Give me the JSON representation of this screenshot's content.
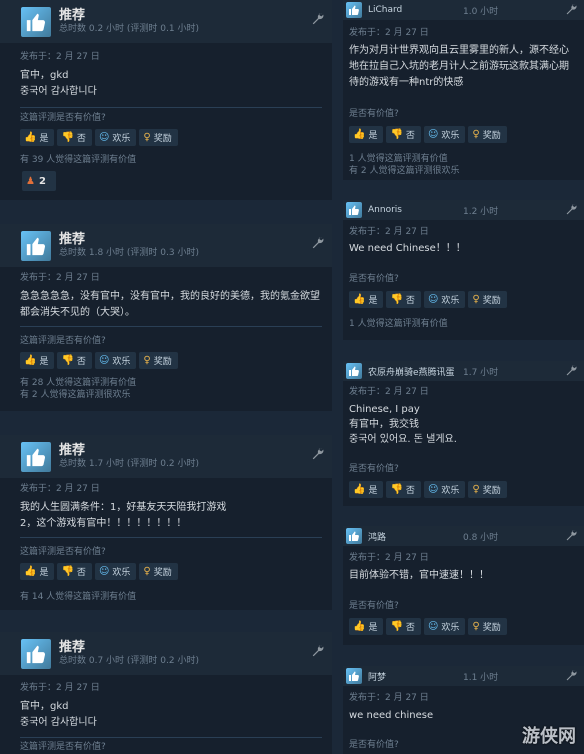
{
  "common": {
    "recommend": "推荐",
    "helpful_q": "这篇评测是否有价值?",
    "yes": "是",
    "no": "否",
    "funny": "欢乐",
    "award": "奖励",
    "helpful_q_short": "是否有价值?"
  },
  "left_reviews": [
    {
      "hours": "总时数 0.2 小时  (评测时 0.1 小时)",
      "posted": "发布于：2 月 27 日",
      "body": [
        "官中，gkd",
        "중국어 감사합니다"
      ],
      "helpful": [
        "有 39 人觉得这篇评测有价值"
      ],
      "award_count": "2"
    },
    {
      "hours": "总时数 1.8 小时  (评测时 0.3 小时)",
      "posted": "发布于：2 月 27 日",
      "body": [
        "急急急急急，没有官中，没有官中，我的良好的美德，我的氪金欲望",
        "都会消失不见的（大哭）。"
      ],
      "helpful": [
        "有 28 人觉得这篇评测有价值",
        "有 2 人觉得这篇评测很欢乐"
      ]
    },
    {
      "hours": "总时数 1.7 小时  (评测时 0.2 小时)",
      "posted": "发布于：2 月 27 日",
      "body": [
        "我的人生圆满条件：1，好基友天天陪我打游戏",
        "2，这个游戏有官中！！！！！！！！"
      ],
      "helpful": [
        "有 14 人觉得这篇评测有价值"
      ]
    },
    {
      "hours": "总时数 0.7 小时  (评测时 0.2 小时)",
      "posted": "发布于：2 月 27 日",
      "body": [
        "官中，gkd",
        "중국어 감사합니다"
      ],
      "ask": "这篇评测是否有价值?"
    }
  ],
  "right_reviews": [
    {
      "user": "LiChard",
      "hours": "1.0 小时",
      "posted": "发布于：2 月 27 日",
      "body": [
        "作为对月计世界观向且云里雾里的新人，源不经心",
        "地在拉自己入坑的老月计人之前游玩这款其满心期",
        "待的游戏有一种ntr的快感"
      ],
      "helpful": [
        "1 人觉得这篇评测有价值",
        "有 2 人觉得这篇评测很欢乐"
      ]
    },
    {
      "user": "Annoris",
      "hours": "1.2 小时",
      "posted": "发布于：2 月 27 日",
      "body": [
        "We need Chinese！！！"
      ],
      "helpful": [
        "1 人觉得这篇评测有价值"
      ]
    },
    {
      "user": "农原舟崩骑e燕腾讯蛋",
      "hours": "1.7 小时",
      "posted": "发布于：2 月 27 日",
      "body": [
        "Chinese, I pay",
        "有官中，我交钱",
        "중국어 있어요. 돈 낼게요."
      ]
    },
    {
      "user": "鸿路",
      "hours": "0.8 小时",
      "posted": "发布于：2 月 27 日",
      "body": [
        "目前体验不错，官中速速！！！"
      ]
    },
    {
      "user": "阿梦",
      "hours": "1.1 小时",
      "posted": "发布于：2 月 27 日",
      "body": [
        "we need chinese"
      ],
      "ask": "是否有价值?"
    }
  ],
  "watermark": "游侠网",
  "colors": {
    "accent": "#67c1f5",
    "bg": "#1b2838",
    "card": "#16202d"
  }
}
